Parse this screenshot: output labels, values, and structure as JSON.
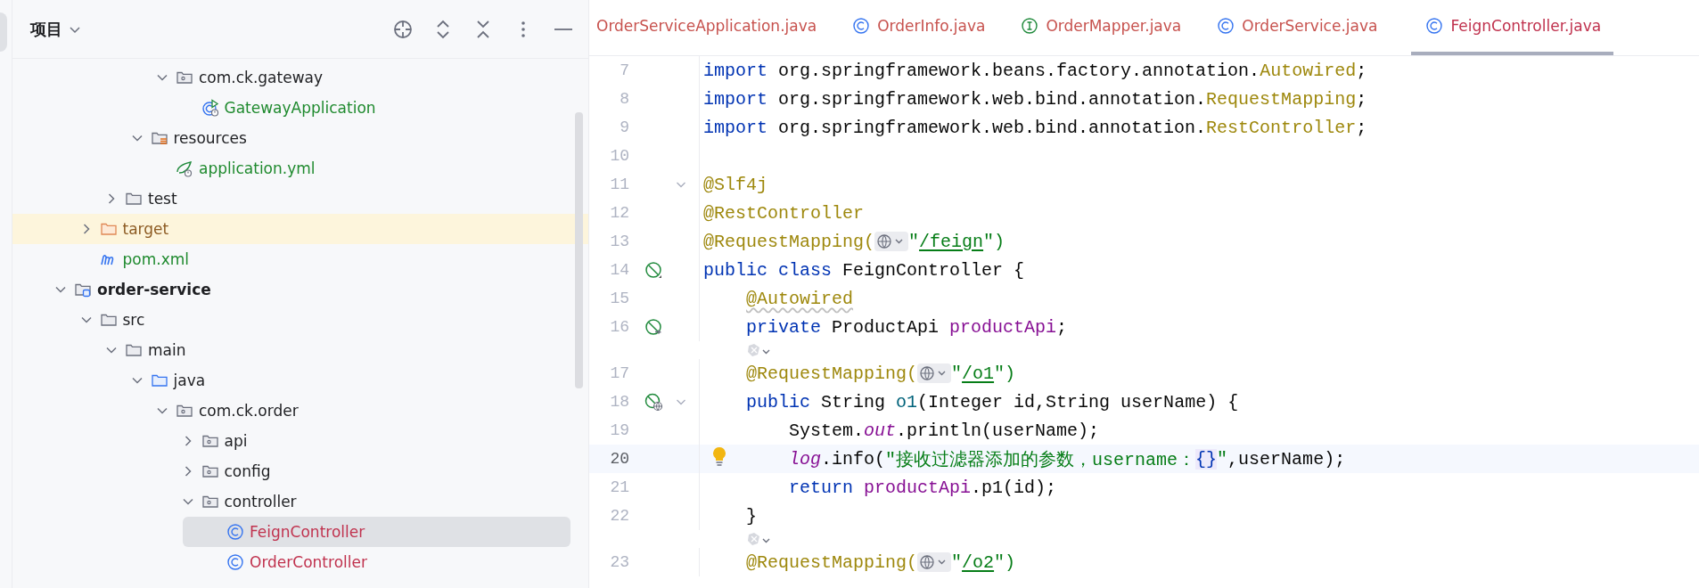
{
  "project_panel": {
    "title": "项目",
    "tree": [
      {
        "children": [
          {
            "children": [
              {
                "children": [
                  {
                    "children": [
                      {
                        "label": "com.ck.gateway",
                        "kind": "package",
                        "expanded": true,
                        "selected": false,
                        "children": [
                          {
                            "label": "GatewayApplication",
                            "kind": "runnable-class",
                            "color": "#1f8a2e",
                            "selected": false
                          }
                        ]
                      }
                    ]
                  },
                  {
                    "label": "resources",
                    "kind": "resources",
                    "expanded": true,
                    "selected": false,
                    "children": [
                      {
                        "label": "application.yml",
                        "kind": "config-file",
                        "color": "#1f8a2e",
                        "selected": false
                      }
                    ]
                  }
                ]
              },
              {
                "label": "test",
                "kind": "folder",
                "expanded": false,
                "selected": false
              }
            ]
          },
          {
            "label": "target",
            "kind": "excluded",
            "expanded": false,
            "selected": false,
            "color": "#8c5a22"
          },
          {
            "label": "pom.xml",
            "kind": "maven",
            "color": "#1f8a2e",
            "selected": false
          }
        ]
      },
      {
        "label": "order-service",
        "kind": "module",
        "expanded": true,
        "selected": false,
        "children": [
          {
            "label": "src",
            "kind": "folder",
            "expanded": true,
            "selected": false,
            "children": [
              {
                "label": "main",
                "kind": "folder",
                "expanded": true,
                "selected": false,
                "children": [
                  {
                    "label": "java",
                    "kind": "source",
                    "expanded": true,
                    "selected": false,
                    "children": [
                      {
                        "label": "com.ck.order",
                        "kind": "package",
                        "expanded": true,
                        "selected": false,
                        "children": [
                          {
                            "label": "api",
                            "kind": "package",
                            "expanded": false,
                            "selected": false
                          },
                          {
                            "label": "config",
                            "kind": "package",
                            "expanded": false,
                            "selected": false
                          },
                          {
                            "label": "controller",
                            "kind": "package",
                            "expanded": true,
                            "selected": false,
                            "children": [
                              {
                                "label": "FeignController",
                                "kind": "class",
                                "color": "#c0324e",
                                "selected": true
                              },
                              {
                                "label": "OrderController",
                                "kind": "class",
                                "color": "#c0324e",
                                "selected": false
                              }
                            ]
                          }
                        ]
                      }
                    ]
                  }
                ]
              }
            ]
          }
        ]
      }
    ]
  },
  "editor": {
    "tabs": [
      {
        "label": "OrderServiceApplication.java",
        "selected": false
      },
      {
        "label": "OrderInfo.java",
        "kind": "class",
        "selected": false
      },
      {
        "label": "OrderMapper.java",
        "kind": "interface",
        "selected": false
      },
      {
        "label": "OrderService.java",
        "kind": "class",
        "selected": false
      },
      {
        "label": "FeignController.java",
        "kind": "class",
        "selected": true
      }
    ],
    "lines": [
      {
        "kind": "code",
        "number": "7",
        "current": false,
        "foldable": false,
        "tokens": [
          {
            "text": "import",
            "kind": "kw"
          },
          {
            "text": " org.springframework.beans.factory.annotation.",
            "kind": "plain"
          },
          {
            "text": "Autowired",
            "kind": "ann"
          },
          {
            "text": ";",
            "kind": "plain"
          }
        ]
      },
      {
        "kind": "code",
        "number": "8",
        "current": false,
        "foldable": false,
        "tokens": [
          {
            "text": "import",
            "kind": "kw"
          },
          {
            "text": " org.springframework.web.bind.annotation.",
            "kind": "plain"
          },
          {
            "text": "RequestMapping",
            "kind": "ann"
          },
          {
            "text": ";",
            "kind": "plain"
          }
        ]
      },
      {
        "kind": "code",
        "number": "9",
        "current": false,
        "foldable": false,
        "tokens": [
          {
            "text": "import",
            "kind": "kw"
          },
          {
            "text": " org.springframework.web.bind.annotation.",
            "kind": "plain"
          },
          {
            "text": "RestController",
            "kind": "ann"
          },
          {
            "text": ";",
            "kind": "plain"
          }
        ]
      },
      {
        "kind": "code",
        "number": "10",
        "current": false,
        "foldable": false
      },
      {
        "kind": "code",
        "number": "11",
        "current": false,
        "foldable": true,
        "tokens": [
          {
            "text": "@Slf4j",
            "kind": "ann"
          }
        ]
      },
      {
        "kind": "code",
        "number": "12",
        "current": false,
        "foldable": false,
        "tokens": [
          {
            "text": "@RestController",
            "kind": "ann"
          }
        ]
      },
      {
        "kind": "code",
        "number": "13",
        "current": false,
        "foldable": false,
        "tokens": [
          {
            "text": "@RequestMapping(",
            "kind": "ann"
          },
          {
            "kind": "inlay"
          },
          {
            "text": "\"",
            "kind": "str"
          },
          {
            "text": "/feign",
            "kind": "url"
          },
          {
            "text": "\")",
            "kind": "str"
          }
        ]
      },
      {
        "kind": "code",
        "number": "14",
        "gutter": {
          "kind": "bean"
        },
        "current": false,
        "foldable": false,
        "tokens": [
          {
            "text": "public class",
            "kind": "kw"
          },
          {
            "text": " FeignController {",
            "kind": "plain"
          }
        ]
      },
      {
        "kind": "code",
        "number": "15",
        "current": false,
        "foldable": false,
        "tokens": [
          {
            "text": "    @Autowired",
            "kind": "ann-warn"
          }
        ]
      },
      {
        "kind": "code",
        "number": "16",
        "gutter": {
          "kind": "autowire"
        },
        "current": false,
        "foldable": false,
        "tokens": [
          {
            "text": "    private",
            "kind": "kw"
          },
          {
            "text": " ProductApi ",
            "kind": "plain"
          },
          {
            "text": "productApi",
            "kind": "field"
          },
          {
            "text": ";",
            "kind": "plain"
          }
        ]
      },
      {
        "kind": "hint"
      },
      {
        "kind": "code",
        "number": "17",
        "current": false,
        "foldable": false,
        "tokens": [
          {
            "text": "    @RequestMapping(",
            "kind": "ann"
          },
          {
            "kind": "inlay"
          },
          {
            "text": "\"",
            "kind": "str"
          },
          {
            "text": "/o1",
            "kind": "url"
          },
          {
            "text": "\")",
            "kind": "str"
          }
        ]
      },
      {
        "kind": "code",
        "number": "18",
        "gutter": {
          "kind": "endpoint"
        },
        "current": false,
        "foldable": true,
        "tokens": [
          {
            "text": "    public",
            "kind": "kw"
          },
          {
            "text": " String ",
            "kind": "plain"
          },
          {
            "text": "o1",
            "kind": "method"
          },
          {
            "text": "(Integer id,String userName) {",
            "kind": "plain"
          }
        ]
      },
      {
        "kind": "code",
        "number": "19",
        "current": false,
        "foldable": false,
        "tokens": [
          {
            "text": "        System.",
            "kind": "plain"
          },
          {
            "text": "out",
            "kind": "static"
          },
          {
            "text": ".println(userName);",
            "kind": "plain"
          }
        ]
      },
      {
        "kind": "code",
        "number": "20",
        "current": true,
        "foldable": false,
        "bulb": true,
        "tokens": [
          {
            "text": "        log",
            "kind": "static"
          },
          {
            "text": ".info(",
            "kind": "plain"
          },
          {
            "text": "\"接收过滤器添加的参数，username：",
            "kind": "str"
          },
          {
            "text": "{}",
            "kind": "brace-hl"
          },
          {
            "text": "\"",
            "kind": "str"
          },
          {
            "text": ",userName);",
            "kind": "plain"
          }
        ]
      },
      {
        "kind": "code",
        "number": "21",
        "current": false,
        "foldable": false,
        "tokens": [
          {
            "text": "        return",
            "kind": "kw"
          },
          {
            "text": " productApi",
            "kind": "field"
          },
          {
            "text": ".p1(id);",
            "kind": "plain"
          }
        ]
      },
      {
        "kind": "code",
        "number": "22",
        "current": false,
        "foldable": false,
        "tokens": [
          {
            "text": "    }",
            "kind": "plain"
          }
        ]
      },
      {
        "kind": "hint"
      },
      {
        "kind": "code",
        "number": "23",
        "current": false,
        "foldable": false,
        "tokens": [
          {
            "text": "    @RequestMapping(",
            "kind": "ann"
          },
          {
            "kind": "inlay"
          },
          {
            "text": "\"",
            "kind": "str"
          },
          {
            "text": "/o2",
            "kind": "url"
          },
          {
            "text": "\")",
            "kind": "str"
          }
        ]
      }
    ]
  }
}
